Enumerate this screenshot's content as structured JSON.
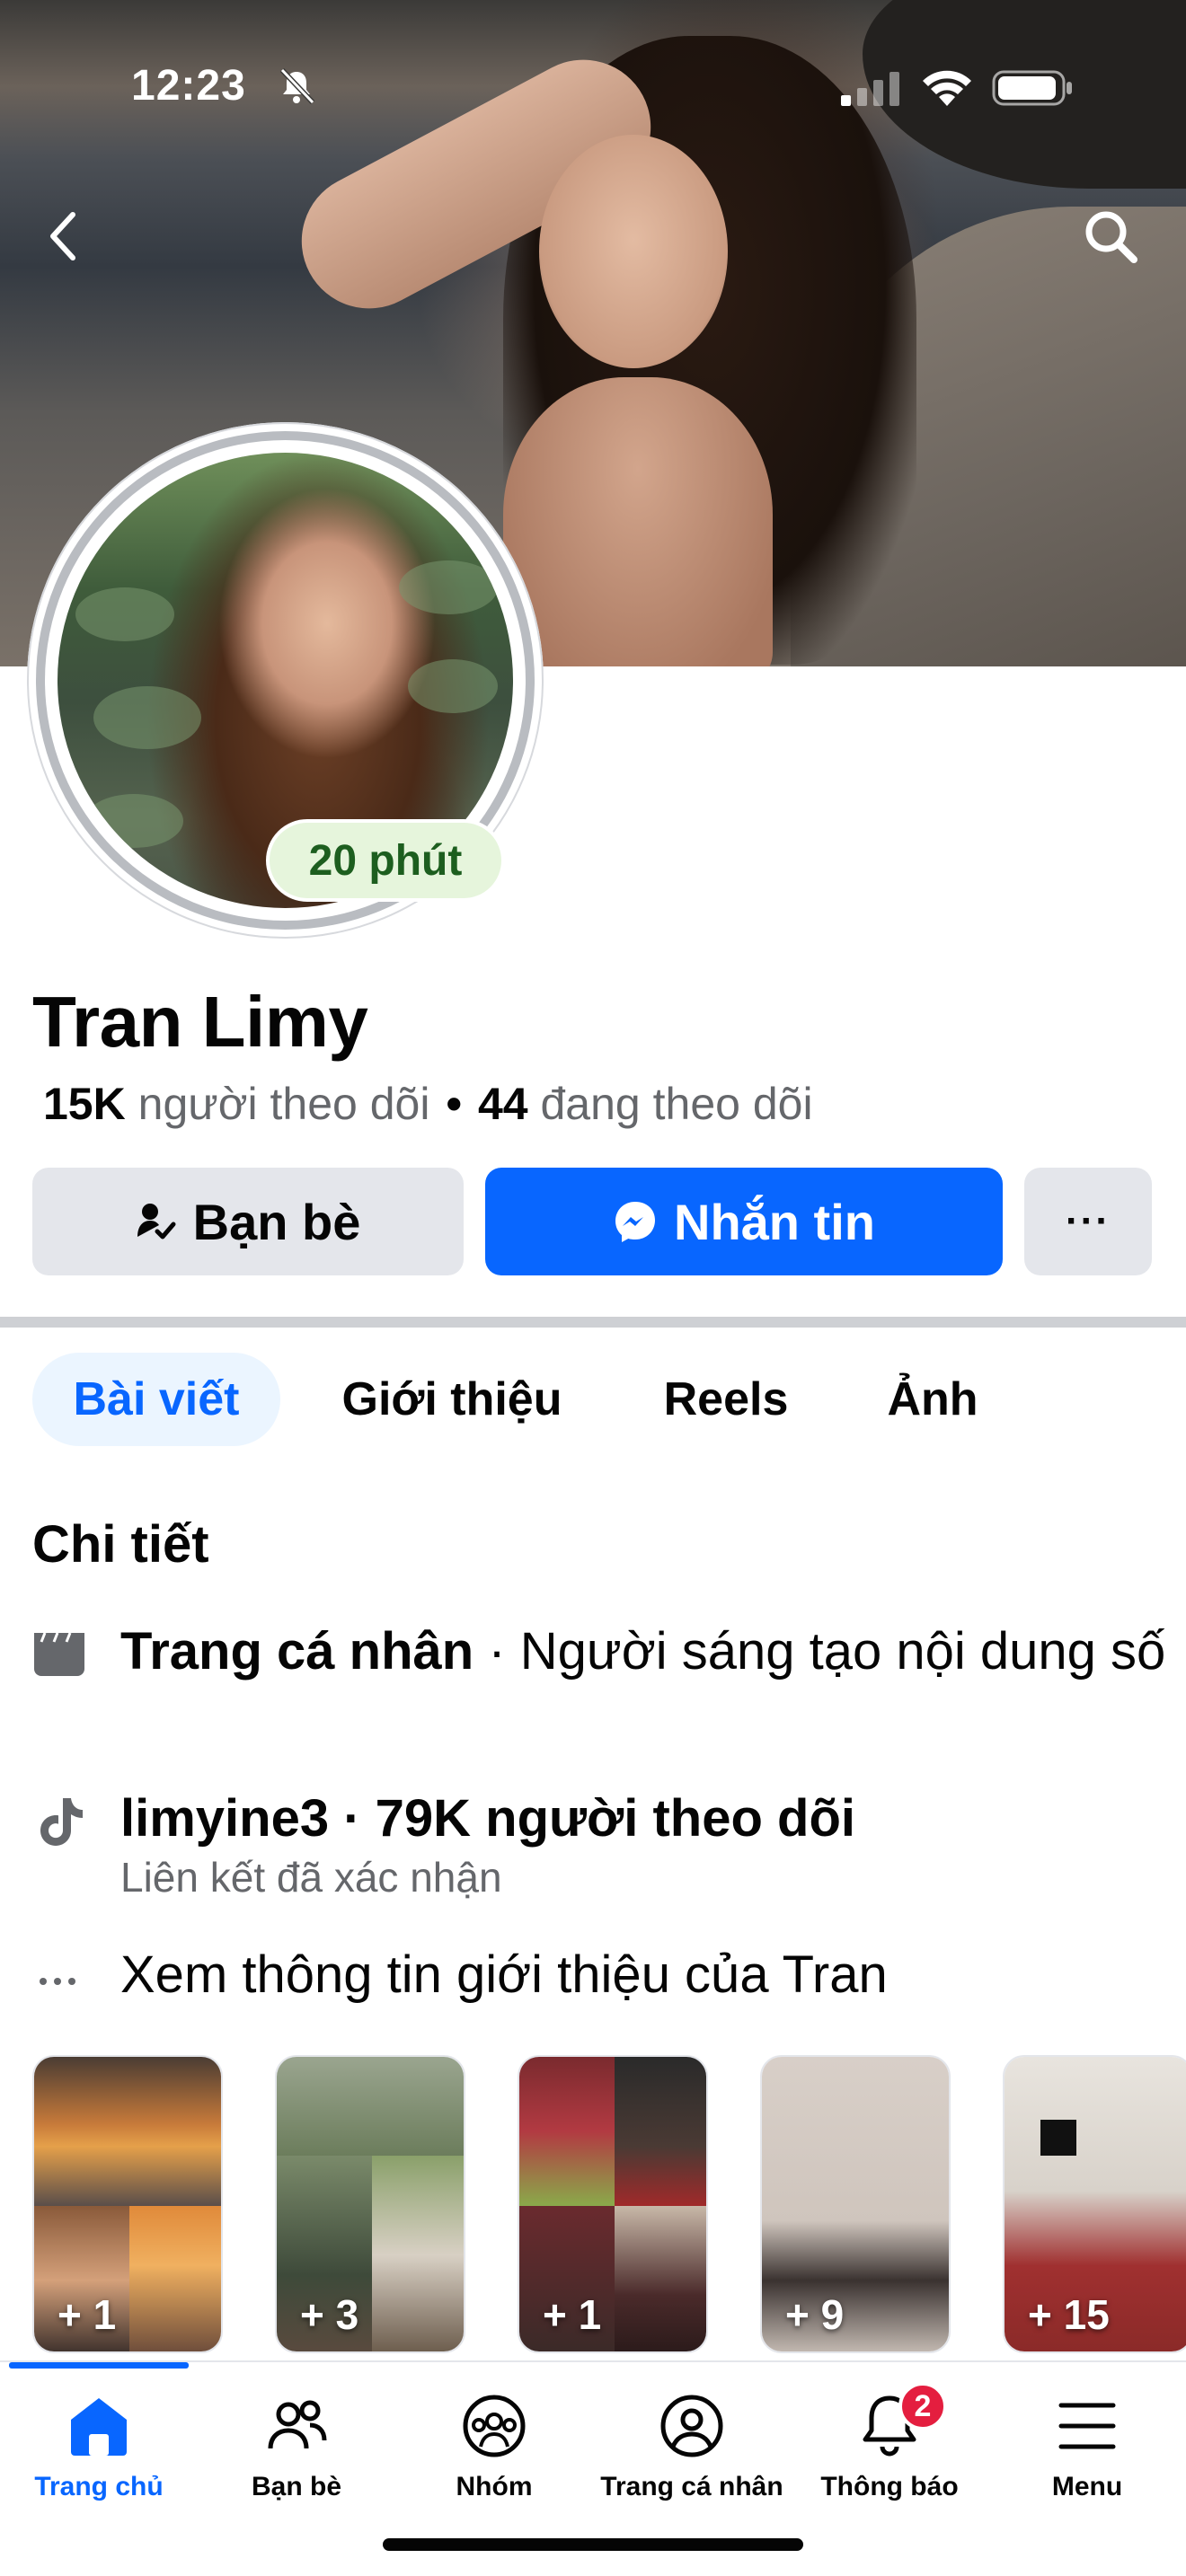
{
  "status_bar": {
    "time": "12:23"
  },
  "profile": {
    "story_badge": "20 phút",
    "name": "Tran Limy",
    "followers_count": "15K",
    "followers_label": "người theo dõi",
    "following_count": "44",
    "following_label": "đang theo dõi"
  },
  "actions": {
    "friends_label": "Bạn bè",
    "message_label": "Nhắn tin",
    "more_label": "···"
  },
  "tabs": [
    {
      "label": "Bài viết",
      "active": true
    },
    {
      "label": "Giới thiệu",
      "active": false
    },
    {
      "label": "Reels",
      "active": false
    },
    {
      "label": "Ảnh",
      "active": false
    }
  ],
  "details": {
    "title": "Chi tiết",
    "page_type_bold": "Trang cá nhân",
    "page_type_rest": " · Người sáng tạo nội dung số",
    "tiktok_line": "limyine3 · 79K người theo dõi",
    "tiktok_sub": "Liên kết đã xác nhận",
    "see_more": "Xem thông tin giới thiệu của Tran"
  },
  "highlights": [
    {
      "count": "+ 1"
    },
    {
      "count": "+ 3"
    },
    {
      "count": "+ 1"
    },
    {
      "count": "+ 9"
    },
    {
      "count": "+ 15"
    }
  ],
  "bottom_nav": {
    "items": [
      {
        "label": "Trang chủ",
        "icon": "home-icon",
        "active": true
      },
      {
        "label": "Bạn bè",
        "icon": "friends-icon",
        "active": false
      },
      {
        "label": "Nhóm",
        "icon": "groups-icon",
        "active": false
      },
      {
        "label": "Trang cá nhân",
        "icon": "profile-icon",
        "active": false
      },
      {
        "label": "Thông báo",
        "icon": "bell-icon",
        "active": false
      },
      {
        "label": "Menu",
        "icon": "menu-icon",
        "active": false
      }
    ],
    "notification_badge": "2"
  },
  "colors": {
    "accent": "#0866ff",
    "secondary_button": "#e4e6eb",
    "badge_red": "#e41e3f",
    "story_badge_bg": "#e6f5dc",
    "story_badge_text": "#1d5e1f"
  }
}
